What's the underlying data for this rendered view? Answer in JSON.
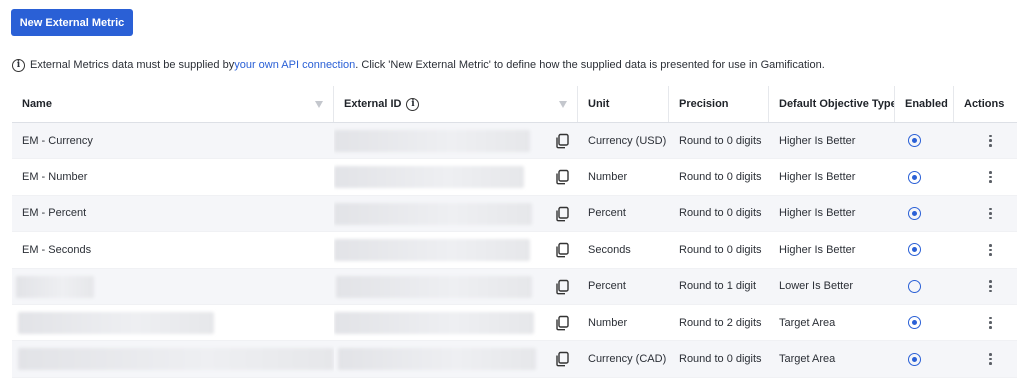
{
  "toolbar": {
    "new_button_label": "New External Metric"
  },
  "info": {
    "prefix": "External Metrics data must be supplied by ",
    "link_text": "your own API connection",
    "suffix": ". Click 'New External Metric' to define how the supplied data is presented for use in Gamification."
  },
  "table": {
    "columns": {
      "name": "Name",
      "external_id": "External ID",
      "unit": "Unit",
      "precision": "Precision",
      "objective_type": "Default Objective Type",
      "enabled": "Enabled",
      "actions": "Actions"
    },
    "rows": [
      {
        "name": "EM - Currency",
        "unit": "Currency (USD)",
        "precision": "Round to 0 digits",
        "objective_type": "Higher Is Better",
        "enabled": true
      },
      {
        "name": "EM - Number",
        "unit": "Number",
        "precision": "Round to 0 digits",
        "objective_type": "Higher Is Better",
        "enabled": true
      },
      {
        "name": "EM - Percent",
        "unit": "Percent",
        "precision": "Round to 0 digits",
        "objective_type": "Higher Is Better",
        "enabled": true
      },
      {
        "name": "EM - Seconds",
        "unit": "Seconds",
        "precision": "Round to 0 digits",
        "objective_type": "Higher Is Better",
        "enabled": true
      },
      {
        "name": "",
        "unit": "Percent",
        "precision": "Round to 1 digit",
        "objective_type": "Lower Is Better",
        "enabled": false
      },
      {
        "name": "",
        "unit": "Number",
        "precision": "Round to 2 digits",
        "objective_type": "Target Area",
        "enabled": true
      },
      {
        "name": "",
        "unit": "Currency (CAD)",
        "precision": "Round to 0 digits",
        "objective_type": "Target Area",
        "enabled": true
      }
    ]
  },
  "colors": {
    "accent": "#2a60d6",
    "row_alt": "#f5f6f9",
    "border": "#e6e8ec"
  },
  "icons": {
    "info": "info-circle-icon",
    "copy": "copy-icon",
    "sort": "sort-triangle-icon",
    "actions": "kebab-menu-icon",
    "enabled": "radio-icon"
  }
}
